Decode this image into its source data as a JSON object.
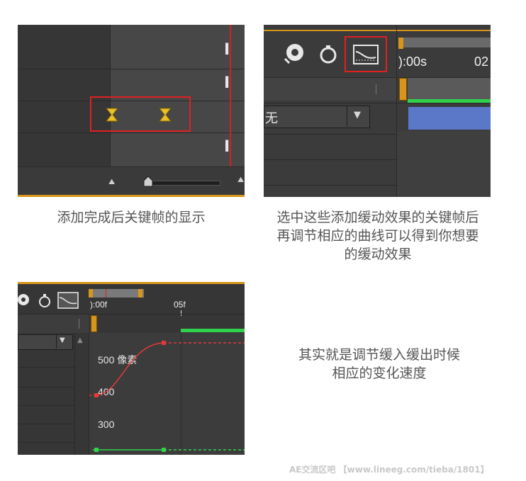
{
  "top_faded_text": "",
  "panels": {
    "p1": {
      "caption": "添加完成后关键帧的显示"
    },
    "p2": {
      "time_label": "):00s",
      "time_label_2": "02",
      "dropdown_value": "无",
      "caption_lines": [
        "选中这些添加缓动效果的关键帧后",
        "再调节相应的曲线可以得到你想要",
        "的缓动效果"
      ]
    },
    "p3": {
      "time_start": "):00f",
      "time_mid": "05f",
      "value_500": "500 像素",
      "value_400": "400",
      "value_300": "300"
    },
    "p4": {
      "caption_lines": [
        "其实就是调节缓入缓出时候",
        "相应的变化速度"
      ]
    }
  },
  "watermark": "AE交流区吧 【www.lineeg.com/tieba/1801】",
  "colors": {
    "panel_bg": "#3a3a3a",
    "accent_orange": "#d7951b",
    "highlight_red": "#e02020",
    "keyframe_yellow": "#e8c02a",
    "graph_red": "#e03a3a",
    "graph_green": "#2fd24a",
    "clip_blue": "#5b78c8"
  }
}
